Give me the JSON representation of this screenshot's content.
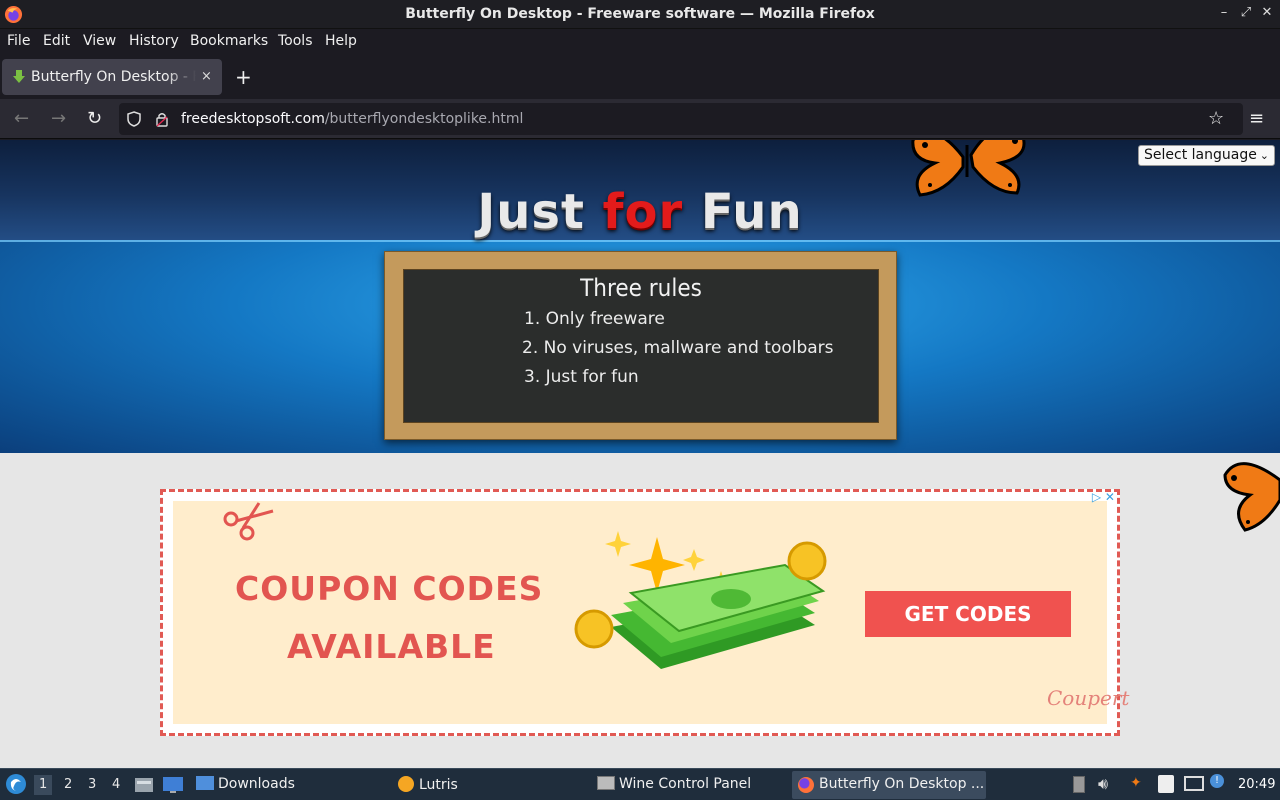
{
  "window": {
    "title": "Butterfly On Desktop - Freeware software — Mozilla Firefox",
    "controls": [
      "minimize-icon",
      "maximize-icon",
      "close-icon"
    ]
  },
  "menubar": {
    "items": [
      "File",
      "Edit",
      "View",
      "History",
      "Bookmarks",
      "Tools",
      "Help"
    ]
  },
  "tab": {
    "title": "Butterfly On Desktop - Freeware software",
    "close": "×"
  },
  "newtab": "+",
  "nav": {
    "url_host": "freedesktopsoft.com",
    "url_path": "/butterflyondesktoplike.html"
  },
  "page": {
    "language_select": "Select language",
    "logo": {
      "word1": "Just",
      "word2": "for",
      "word3": "Fun"
    },
    "rules": {
      "title": "Three rules",
      "items": [
        "1. Only freeware",
        "2. No viruses, mallware and toolbars",
        "3. Just for fun"
      ]
    },
    "ad": {
      "line1": "COUPON CODES",
      "line2": "AVAILABLE",
      "cta": "GET CODES",
      "brand": "Coupert",
      "choices": "▷ ✕"
    }
  },
  "taskbar": {
    "workspaces": [
      "1",
      "2",
      "3",
      "4"
    ],
    "tasks": {
      "downloads": "Downloads",
      "lutris": "Lutris",
      "wine": "Wine Control Panel",
      "firefox": "Butterfly On Desktop ..."
    },
    "clock": "20:49"
  },
  "colors": {
    "accent_red": "#e31b1b",
    "ad_red": "#f0524f",
    "header_blue": "#1478c4"
  }
}
